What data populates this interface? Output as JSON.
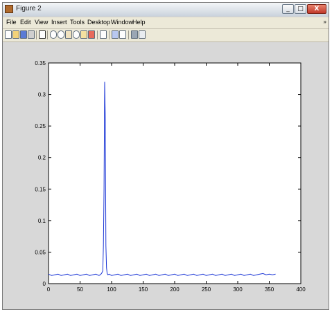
{
  "window": {
    "title": "Figure 2",
    "buttons": {
      "minimize": "_",
      "maximize": "□",
      "close": "X"
    }
  },
  "menu": [
    "File",
    "Edit",
    "View",
    "Insert",
    "Tools",
    "Desktop",
    "Window",
    "Help"
  ],
  "menu_overflow": "»",
  "toolbar_icons": [
    "new-figure-icon",
    "open-file-icon",
    "save-icon",
    "print-icon",
    "pointer-icon",
    "zoom-in-icon",
    "zoom-out-icon",
    "pan-icon",
    "rotate-icon",
    "data-cursor-icon",
    "brush-icon",
    "link-icon",
    "colorbar-icon",
    "legend-icon",
    "hide-plot-tools-icon",
    "show-plot-tools-icon"
  ],
  "colors": {
    "line": "#1a35d6",
    "figure_bg": "#d8d8d8",
    "axes_bg": "#ffffff"
  },
  "chart_data": {
    "type": "line",
    "title": "",
    "xlabel": "",
    "ylabel": "",
    "xlim": [
      0,
      400
    ],
    "ylim": [
      0,
      0.35
    ],
    "xticks": [
      0,
      50,
      100,
      150,
      200,
      250,
      300,
      350,
      400
    ],
    "yticks": [
      0,
      0.05,
      0.1,
      0.15,
      0.2,
      0.25,
      0.3,
      0.35
    ],
    "xtick_labels": [
      "0",
      "50",
      "100",
      "150",
      "200",
      "250",
      "300",
      "350",
      "400"
    ],
    "ytick_labels": [
      "0",
      "0.05",
      "0.1",
      "0.15",
      "0.2",
      "0.25",
      "0.3",
      "0.35"
    ],
    "grid": false,
    "series": [
      {
        "x": [
          0,
          5,
          10,
          15,
          20,
          25,
          30,
          35,
          40,
          45,
          50,
          55,
          60,
          65,
          70,
          75,
          80,
          82,
          84,
          86,
          87,
          88,
          89,
          90,
          91,
          92,
          93,
          94,
          96,
          100,
          105,
          110,
          115,
          120,
          125,
          130,
          135,
          140,
          145,
          150,
          155,
          160,
          165,
          170,
          175,
          180,
          185,
          190,
          195,
          200,
          205,
          210,
          215,
          220,
          225,
          230,
          235,
          240,
          245,
          250,
          255,
          260,
          265,
          270,
          275,
          280,
          285,
          290,
          295,
          300,
          305,
          310,
          315,
          320,
          325,
          330,
          335,
          340,
          345,
          350,
          355,
          360
        ],
        "y": [
          0.015,
          0.013,
          0.014,
          0.015,
          0.013,
          0.014,
          0.015,
          0.013,
          0.014,
          0.015,
          0.013,
          0.014,
          0.015,
          0.013,
          0.014,
          0.015,
          0.013,
          0.014,
          0.016,
          0.02,
          0.06,
          0.15,
          0.32,
          0.26,
          0.06,
          0.025,
          0.016,
          0.014,
          0.015,
          0.013,
          0.014,
          0.015,
          0.013,
          0.014,
          0.015,
          0.013,
          0.014,
          0.015,
          0.013,
          0.014,
          0.015,
          0.013,
          0.014,
          0.015,
          0.013,
          0.014,
          0.015,
          0.013,
          0.014,
          0.015,
          0.013,
          0.014,
          0.015,
          0.013,
          0.014,
          0.015,
          0.013,
          0.014,
          0.015,
          0.013,
          0.014,
          0.015,
          0.013,
          0.014,
          0.015,
          0.013,
          0.014,
          0.015,
          0.013,
          0.014,
          0.015,
          0.013,
          0.014,
          0.015,
          0.013,
          0.014,
          0.015,
          0.016,
          0.014,
          0.015,
          0.014,
          0.015
        ]
      }
    ]
  }
}
